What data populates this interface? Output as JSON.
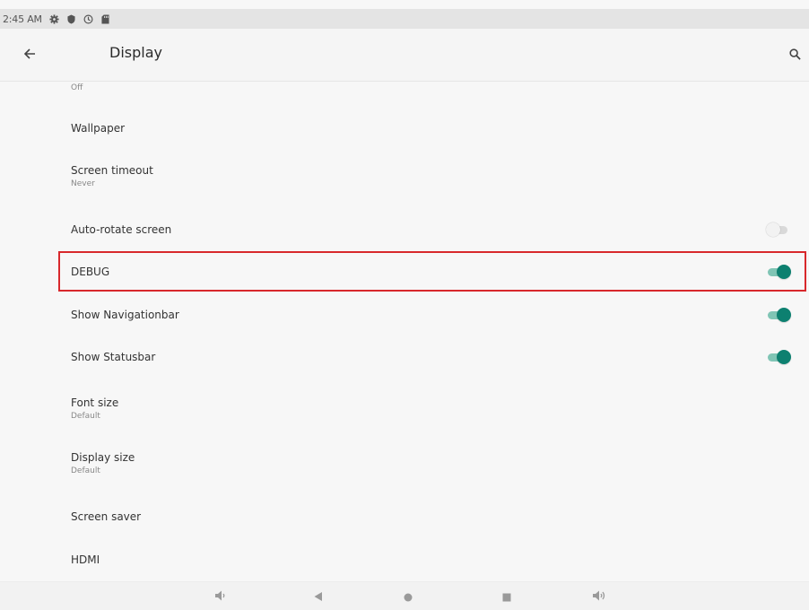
{
  "status_bar": {
    "time": "2:45 AM",
    "icons": [
      "gear-icon",
      "shield-icon",
      "sync-icon",
      "sd-card-icon"
    ]
  },
  "toolbar": {
    "title": "Display",
    "back_icon": "arrow-left-icon",
    "search_icon": "search-icon"
  },
  "settings": {
    "top_summary": "Off",
    "items": [
      {
        "label": "Wallpaper"
      },
      {
        "label": "Screen timeout",
        "summary": "Never"
      },
      {
        "label": "Auto-rotate screen",
        "toggle": false
      },
      {
        "label": "DEBUG",
        "toggle": true,
        "highlighted": true
      },
      {
        "label": "Show Navigationbar",
        "toggle": true
      },
      {
        "label": "Show Statusbar",
        "toggle": true
      },
      {
        "label": "Font size",
        "summary": "Default"
      },
      {
        "label": "Display size",
        "summary": "Default"
      },
      {
        "label": "Screen saver"
      },
      {
        "label": "HDMI"
      }
    ]
  },
  "nav_bar": {
    "icons": [
      "volume-down-icon",
      "back-triangle-icon",
      "home-circle-icon",
      "recents-square-icon",
      "volume-up-icon"
    ]
  },
  "colors": {
    "accent": "#0d8070",
    "accent_track": "#80c5b5",
    "highlight_border": "#d8282c"
  }
}
